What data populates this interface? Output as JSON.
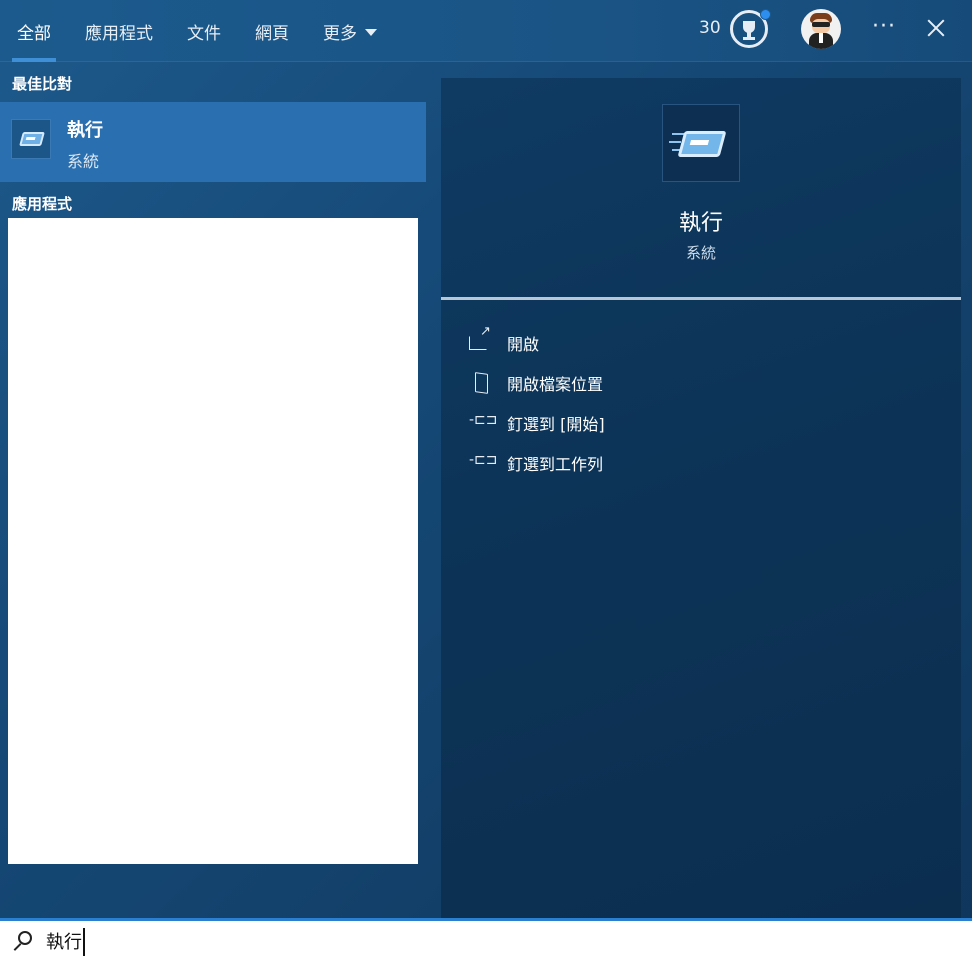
{
  "tabs": [
    {
      "label": "全部",
      "active": true
    },
    {
      "label": "應用程式",
      "active": false
    },
    {
      "label": "文件",
      "active": false
    },
    {
      "label": "網頁",
      "active": false
    },
    {
      "label": "更多",
      "active": false
    }
  ],
  "header": {
    "points": "30",
    "reward_icon": "trophy-icon",
    "more_icon": "ellipsis-icon",
    "more_label": "···",
    "close_icon": "close-icon",
    "accent_color": "#3f8fd6"
  },
  "left": {
    "best_match_title": "最佳比對",
    "best_match": {
      "name": "執行",
      "category": "系統",
      "icon": "run-icon"
    },
    "apps_title": "應用程式"
  },
  "detail": {
    "name": "執行",
    "category": "系統",
    "actions": [
      {
        "label": "開啟",
        "icon": "open-icon"
      },
      {
        "label": "開啟檔案位置",
        "icon": "folder-icon"
      },
      {
        "label": "釘選到 [開始]",
        "icon": "pin-icon"
      },
      {
        "label": "釘選到工作列",
        "icon": "pin-icon"
      }
    ]
  },
  "search": {
    "value": "執行",
    "icon": "search-icon"
  }
}
